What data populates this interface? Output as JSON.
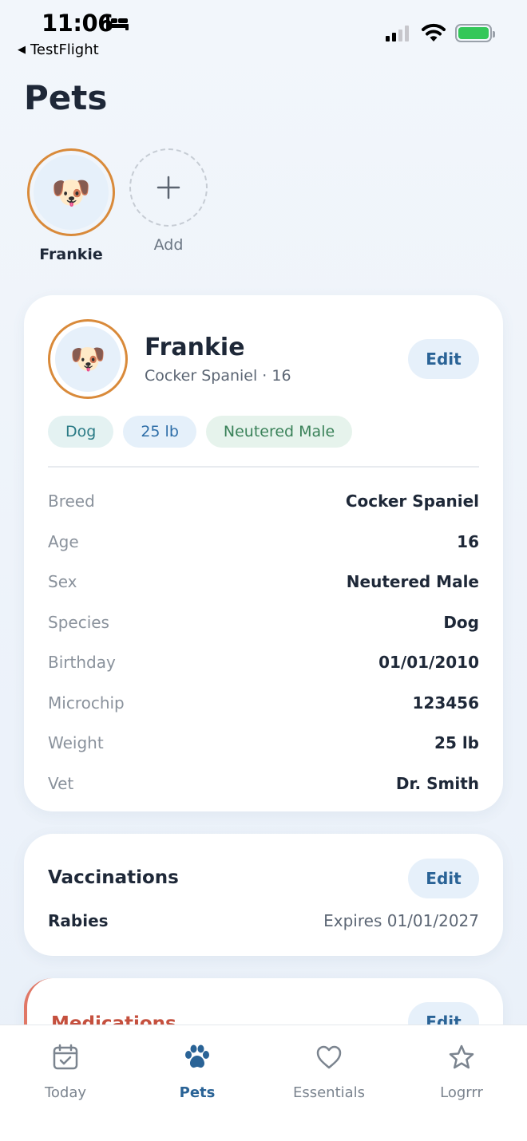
{
  "status_bar": {
    "time": "11:06",
    "back_label": "TestFlight"
  },
  "page": {
    "title": "Pets"
  },
  "pet_selector": [
    {
      "name": "Frankie",
      "icon": "dog-face-icon"
    },
    {
      "name": "Add",
      "icon": "plus-icon"
    }
  ],
  "profile": {
    "name": "Frankie",
    "subtitle": "Cocker Spaniel · 16",
    "edit_label": "Edit",
    "tags": [
      "Dog",
      "25 lb",
      "Neutered Male"
    ],
    "details": [
      {
        "label": "Breed",
        "value": "Cocker Spaniel"
      },
      {
        "label": "Age",
        "value": "16"
      },
      {
        "label": "Sex",
        "value": "Neutered Male"
      },
      {
        "label": "Species",
        "value": "Dog"
      },
      {
        "label": "Birthday",
        "value": "01/01/2010"
      },
      {
        "label": "Microchip",
        "value": "123456"
      },
      {
        "label": "Weight",
        "value": "25 lb"
      },
      {
        "label": "Vet",
        "value": "Dr. Smith"
      }
    ]
  },
  "vaccinations": {
    "title": "Vaccinations",
    "edit_label": "Edit",
    "items": [
      {
        "name": "Rabies",
        "expires": "Expires 01/01/2027"
      }
    ]
  },
  "medications": {
    "title": "Medications",
    "edit_label": "Edit"
  },
  "tab_bar": {
    "tabs": [
      {
        "label": "Today",
        "icon": "calendar-check-icon",
        "active": false
      },
      {
        "label": "Pets",
        "icon": "paw-icon",
        "active": true
      },
      {
        "label": "Essentials",
        "icon": "heart-icon",
        "active": false
      },
      {
        "label": "Logrrr",
        "icon": "star-icon",
        "active": false
      }
    ]
  },
  "colors": {
    "accent": "#2a6396",
    "avatar_ring": "#d98a3a",
    "medications": "#c5503e",
    "battery": "#34c759"
  }
}
